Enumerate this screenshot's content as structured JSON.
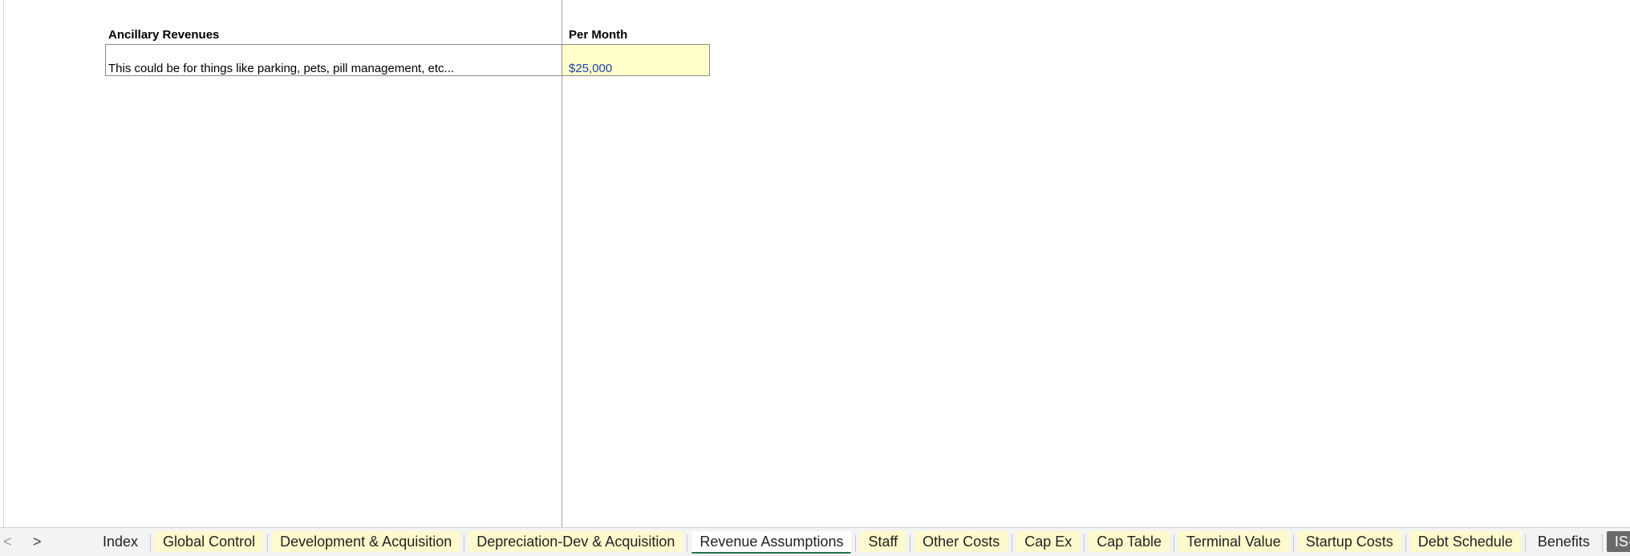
{
  "sheet": {
    "header_left": "Ancillary Revenues",
    "header_right": "Per Month",
    "description": "This could be for things like parking, pets, pill management, etc...",
    "value": "$25,000"
  },
  "tabbar": {
    "nav_prev": "<",
    "nav_next": ">",
    "tabs": [
      {
        "label": "Index"
      },
      {
        "label": "Global Control"
      },
      {
        "label": "Development & Acquisition"
      },
      {
        "label": "Depreciation-Dev & Acquisition"
      },
      {
        "label": "Revenue Assumptions"
      },
      {
        "label": "Staff"
      },
      {
        "label": "Other Costs"
      },
      {
        "label": "Cap Ex"
      },
      {
        "label": "Cap Table"
      },
      {
        "label": "Terminal Value"
      },
      {
        "label": "Startup Costs"
      },
      {
        "label": "Debt Schedule"
      },
      {
        "label": "Benefits"
      },
      {
        "label": "IS- M"
      }
    ]
  },
  "colors": {
    "input_cell": "#ffffcc",
    "input_text": "#1f3fa8",
    "active_tab_accent": "#217346",
    "tab_yellow": "#fffacd"
  }
}
